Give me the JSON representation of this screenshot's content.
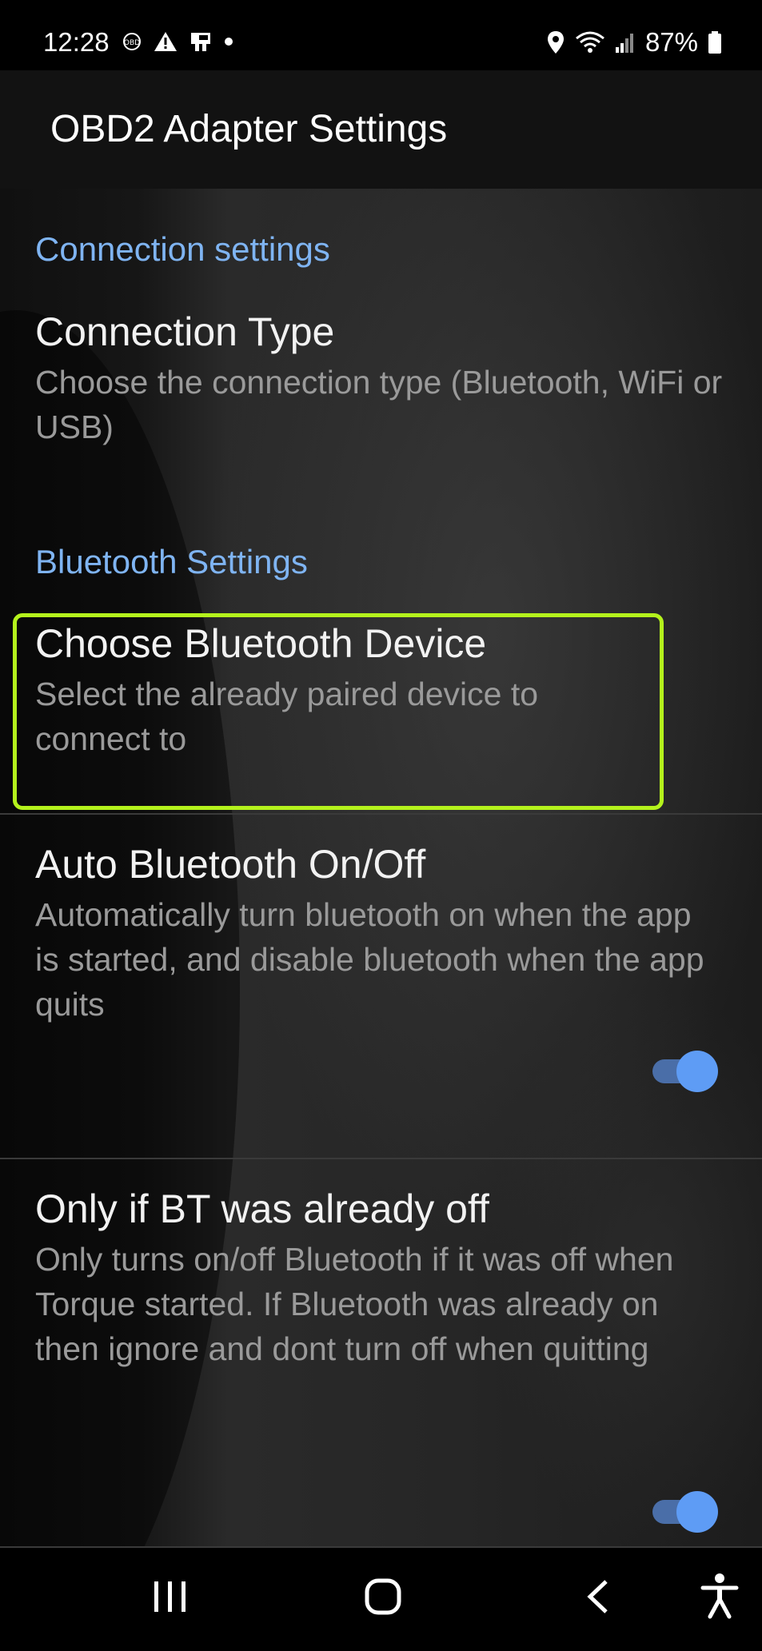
{
  "status": {
    "time": "12:28",
    "battery": "87%",
    "left_icons": [
      "obd-icon",
      "warning-icon",
      "cast-icon",
      "dot-icon"
    ],
    "right_icons": [
      "location-icon",
      "wifi-icon",
      "signal-icon",
      "battery-icon"
    ]
  },
  "appbar": {
    "title": "OBD2 Adapter Settings"
  },
  "sections": {
    "connection": {
      "header": "Connection settings",
      "connection_type": {
        "title": "Connection Type",
        "summary": "Choose the connection type (Bluetooth, WiFi or USB)"
      }
    },
    "bluetooth": {
      "header": "Bluetooth Settings",
      "choose_device": {
        "title": "Choose Bluetooth Device",
        "summary": "Select the already paired device to connect to"
      },
      "auto_bt": {
        "title": "Auto Bluetooth On/Off",
        "summary": "Automatically turn bluetooth on when the app is started, and disable bluetooth when the app quits",
        "enabled": true
      },
      "only_if_off": {
        "title": "Only if BT was already off",
        "summary": "Only turns on/off Bluetooth if it was off when Torque started. If Bluetooth was already on then ignore and dont turn off when quitting",
        "enabled": true
      }
    }
  },
  "navbar": {
    "icons": [
      "recents-icon",
      "home-icon",
      "back-icon",
      "accessibility-icon"
    ]
  },
  "colors": {
    "section_header": "#7fb4f2",
    "highlight": "#b4f21c",
    "switch_thumb": "#5e9cf5"
  }
}
